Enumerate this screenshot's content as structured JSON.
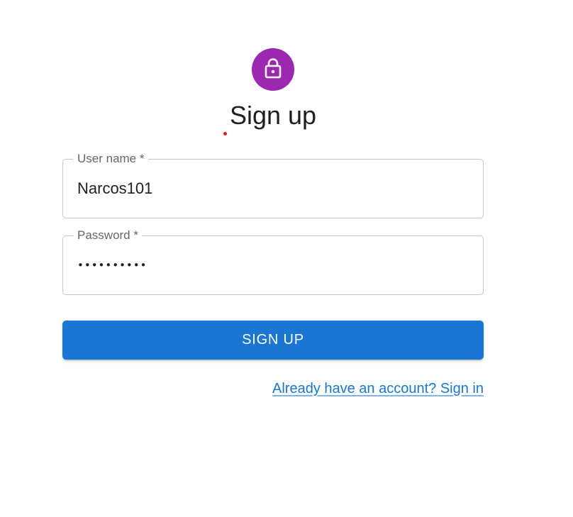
{
  "colors": {
    "avatar_bg": "#9c27b0",
    "primary": "#1976d2",
    "border": "#c4c4c4",
    "label": "#666666",
    "indicator_dot": "#e5192b"
  },
  "header": {
    "icon": "lock-icon",
    "title": "Sign up"
  },
  "form": {
    "username": {
      "label": "User name *",
      "value": "Narcos101"
    },
    "password": {
      "label": "Password *",
      "value": "••••••••••"
    },
    "submit_label": "SIGN UP",
    "signin_link": "Already have an account? Sign in"
  }
}
